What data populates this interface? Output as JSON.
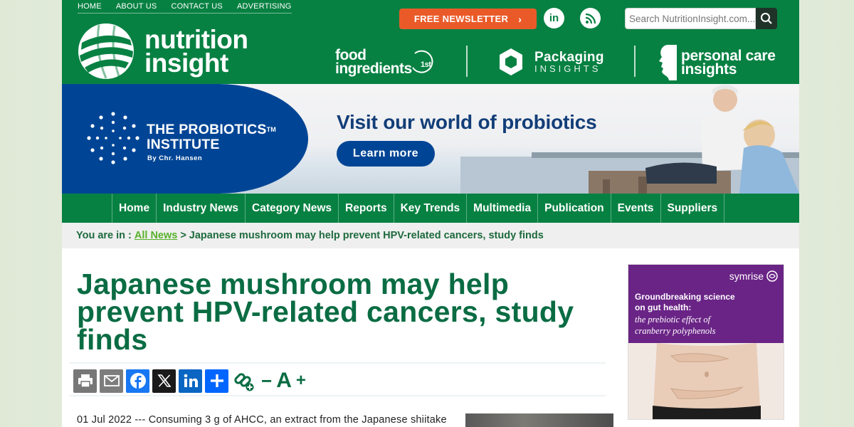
{
  "header": {
    "top_links": [
      "HOME",
      "ABOUT US",
      "CONTACT US",
      "ADVERTISING"
    ],
    "logo_line1": "nutrition",
    "logo_line2": "insight",
    "newsletter_label": "FREE NEWSLETTER",
    "social": [
      {
        "icon": "linkedin-icon",
        "glyph": "in"
      },
      {
        "icon": "rss-icon",
        "glyph": ""
      }
    ],
    "search_placeholder": "Search NutritionInsight.com...",
    "brands": {
      "food_line1": "food",
      "food_line2": "ingredients",
      "food_badge": "1st",
      "pack_line1": "Packaging",
      "pack_line2": "INSIGHTS",
      "pc_line1": "personal care",
      "pc_line2": "insights"
    }
  },
  "banner": {
    "org_line1": "THE PROBIOTICS",
    "org_line2": "INSTITUTE",
    "org_tm": "TM",
    "org_sub": "By Chr. Hansen",
    "headline": "Visit our world of probiotics",
    "cta": "Learn more"
  },
  "nav": {
    "items": [
      "Home",
      "Industry News",
      "Category News",
      "Reports",
      "Key Trends",
      "Multimedia",
      "Publication",
      "Events",
      "Suppliers"
    ]
  },
  "breadcrumb": {
    "prefix": "You are in :",
    "link": "All News",
    "sep": ">",
    "current": "Japanese mushroom may help prevent HPV-related cancers, study finds"
  },
  "article": {
    "title": "Japanese mushroom may help prevent HPV-related cancers, study finds",
    "font_minus": "−",
    "font_a": "A",
    "font_plus": "+",
    "lead": "01 Jul 2022 --- Consuming 3 g of AHCC, an extract from the Japanese shiitake"
  },
  "ad": {
    "brand": "symrise",
    "headline_line1": "Groundbreaking science",
    "headline_line2": "on gut health:",
    "sub_line1": "the prebiotic effect of",
    "sub_line2": "cranberry polyphenols"
  },
  "colors": {
    "brand_green": "#078142",
    "title_green": "#0a6c43",
    "newsletter_orange": "#ea5a29",
    "banner_blue": "#004595",
    "ad_purple": "#6a2486"
  }
}
